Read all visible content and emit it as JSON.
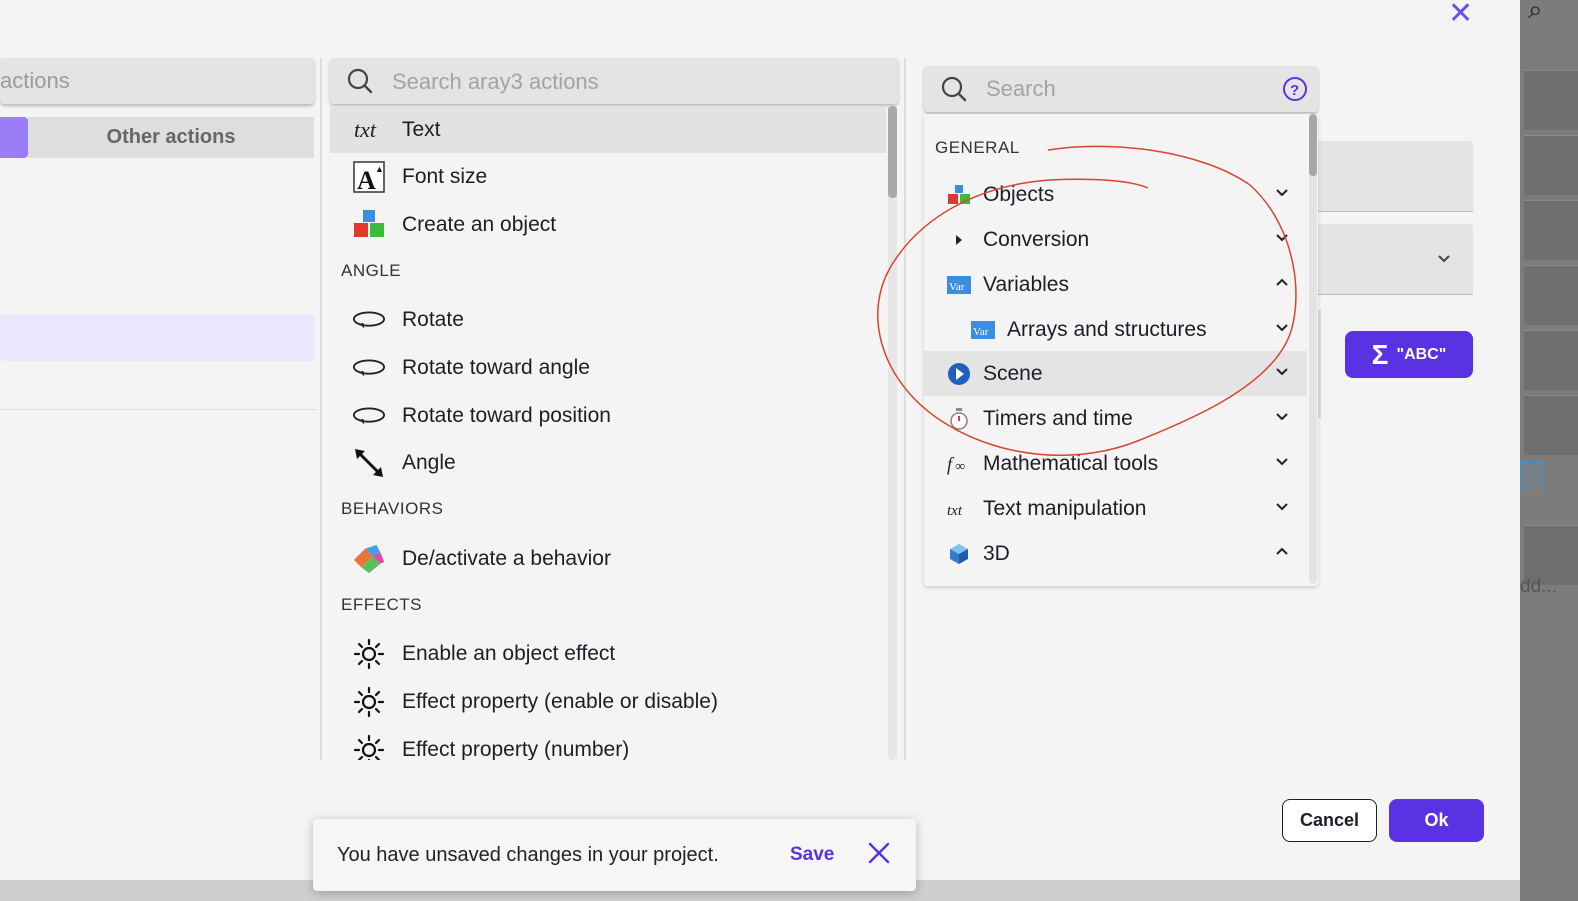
{
  "left_panel": {
    "search_text": "actions",
    "tab_other_label": "Other actions"
  },
  "middle_panel": {
    "search_placeholder": "Search aray3 actions",
    "items": [
      {
        "label": "Text",
        "icon": "txt-icon",
        "selected": true
      },
      {
        "label": "Font size",
        "icon": "font-size-icon"
      },
      {
        "label": "Create an object",
        "icon": "create-object-icon"
      }
    ],
    "sections": [
      {
        "title": "ANGLE",
        "items": [
          {
            "label": "Rotate",
            "icon": "rotate-icon"
          },
          {
            "label": "Rotate toward angle",
            "icon": "rotate-icon"
          },
          {
            "label": "Rotate toward position",
            "icon": "rotate-icon"
          },
          {
            "label": "Angle",
            "icon": "angle-arrow-icon"
          }
        ]
      },
      {
        "title": "BEHAVIORS",
        "items": [
          {
            "label": "De/activate a behavior",
            "icon": "behavior-icon"
          }
        ]
      },
      {
        "title": "EFFECTS",
        "items": [
          {
            "label": "Enable an object effect",
            "icon": "effect-icon"
          },
          {
            "label": "Effect property (enable or disable)",
            "icon": "effect-icon"
          },
          {
            "label": "Effect property (number)",
            "icon": "effect-icon"
          }
        ]
      }
    ]
  },
  "right_popup": {
    "search_placeholder": "Search",
    "section_title": "GENERAL",
    "categories": [
      {
        "label": "Objects",
        "icon": "objects-icon",
        "expanded": false
      },
      {
        "label": "Conversion",
        "icon": "caret-right-icon",
        "expanded": false
      },
      {
        "label": "Variables",
        "icon": "var-icon",
        "expanded": true
      },
      {
        "label": "Arrays and structures",
        "icon": "var-icon",
        "expanded": false,
        "child": true
      },
      {
        "label": "Scene",
        "icon": "scene-play-icon",
        "expanded": false,
        "highlighted": true
      },
      {
        "label": "Timers and time",
        "icon": "timer-icon",
        "expanded": false
      },
      {
        "label": "Mathematical tools",
        "icon": "math-fx-icon",
        "expanded": false
      },
      {
        "label": "Text manipulation",
        "icon": "txt-icon",
        "expanded": false
      },
      {
        "label": "3D",
        "icon": "cube-3d-icon",
        "expanded": true
      }
    ]
  },
  "expression_button": {
    "sigma": "Σ",
    "label": "\"ABC\""
  },
  "footer": {
    "cancel_label": "Cancel",
    "ok_label": "Ok"
  },
  "snackbar": {
    "message": "You have unsaved changes in your project.",
    "save_label": "Save"
  },
  "background": {
    "partial_text": "dd..."
  },
  "colors": {
    "accent": "#5a31e3",
    "accent_light": "#9c7df8",
    "annotation": "#d9442e"
  }
}
